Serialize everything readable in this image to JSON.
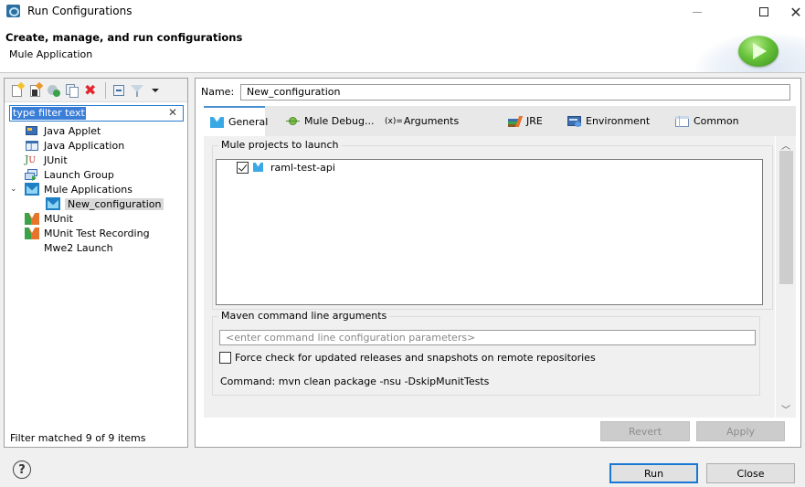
{
  "window": {
    "title": "Run Configurations",
    "controls": {
      "minimize": "—",
      "maximize": "☐",
      "close": "✕"
    }
  },
  "banner": {
    "title": "Create, manage, and run configurations",
    "subtitle": "Mule Application"
  },
  "left_panel": {
    "toolbar_icons": [
      "new-configuration-icon",
      "new-prototype-icon",
      "export-icon",
      "duplicate-icon",
      "delete-icon",
      "collapse-all-icon",
      "filter-icon",
      "view-menu-icon"
    ],
    "filter": {
      "value": "type filter text",
      "clear_label": "✕"
    },
    "tree": [
      {
        "label": "Java Applet",
        "icon": "java-applet-icon",
        "level": 0
      },
      {
        "label": "Java Application",
        "icon": "java-application-icon",
        "level": 0
      },
      {
        "label": "JUnit",
        "icon": "junit-icon",
        "level": 0
      },
      {
        "label": "Launch Group",
        "icon": "launch-group-icon",
        "level": 0
      },
      {
        "label": "Mule Applications",
        "icon": "mule-icon",
        "level": 0,
        "expanded": true
      },
      {
        "label": "New_configuration",
        "icon": "mule-icon",
        "level": 1,
        "selected": true
      },
      {
        "label": "MUnit",
        "icon": "munit-icon",
        "level": 0
      },
      {
        "label": "MUnit Test Recording",
        "icon": "munit-icon",
        "level": 0
      },
      {
        "label": "Mwe2 Launch",
        "icon": "",
        "level": 0
      }
    ],
    "status": "Filter matched 9 of 9 items"
  },
  "right_panel": {
    "name_label": "Name:",
    "name_value": "New_configuration",
    "tabs": [
      {
        "label": "General",
        "icon": "mule-icon",
        "active": true
      },
      {
        "label": "Mule Debug...",
        "icon": "bug-icon",
        "active": false
      },
      {
        "label": "Arguments",
        "icon": "arguments-icon",
        "icon_text": "(x)=",
        "active": false
      },
      {
        "label": "JRE",
        "icon": "jre-icon",
        "active": false
      },
      {
        "label": "Environment",
        "icon": "environment-icon",
        "active": false
      },
      {
        "label": "Common",
        "icon": "common-icon",
        "active": false
      }
    ],
    "general": {
      "projects_group_label": "Mule projects to launch",
      "projects": [
        {
          "name": "raml-test-api",
          "checked": true
        }
      ],
      "maven_group_label": "Maven command line arguments",
      "maven_placeholder": "<enter command line configuration parameters>",
      "force_check_label": "Force check for updated releases and snapshots on remote repositories",
      "force_check_checked": false,
      "command_text": "Command:  mvn clean package -nsu -DskipMunitTests"
    },
    "buttons": {
      "revert": "Revert",
      "apply": "Apply"
    }
  },
  "footer": {
    "help_label": "?",
    "run_label": "Run",
    "close_label": "Close"
  },
  "colors": {
    "accent": "#1979d2",
    "selection": "#3b7ed8",
    "mule_blue": "#29a9e0",
    "run_green": "#4fb02c"
  }
}
